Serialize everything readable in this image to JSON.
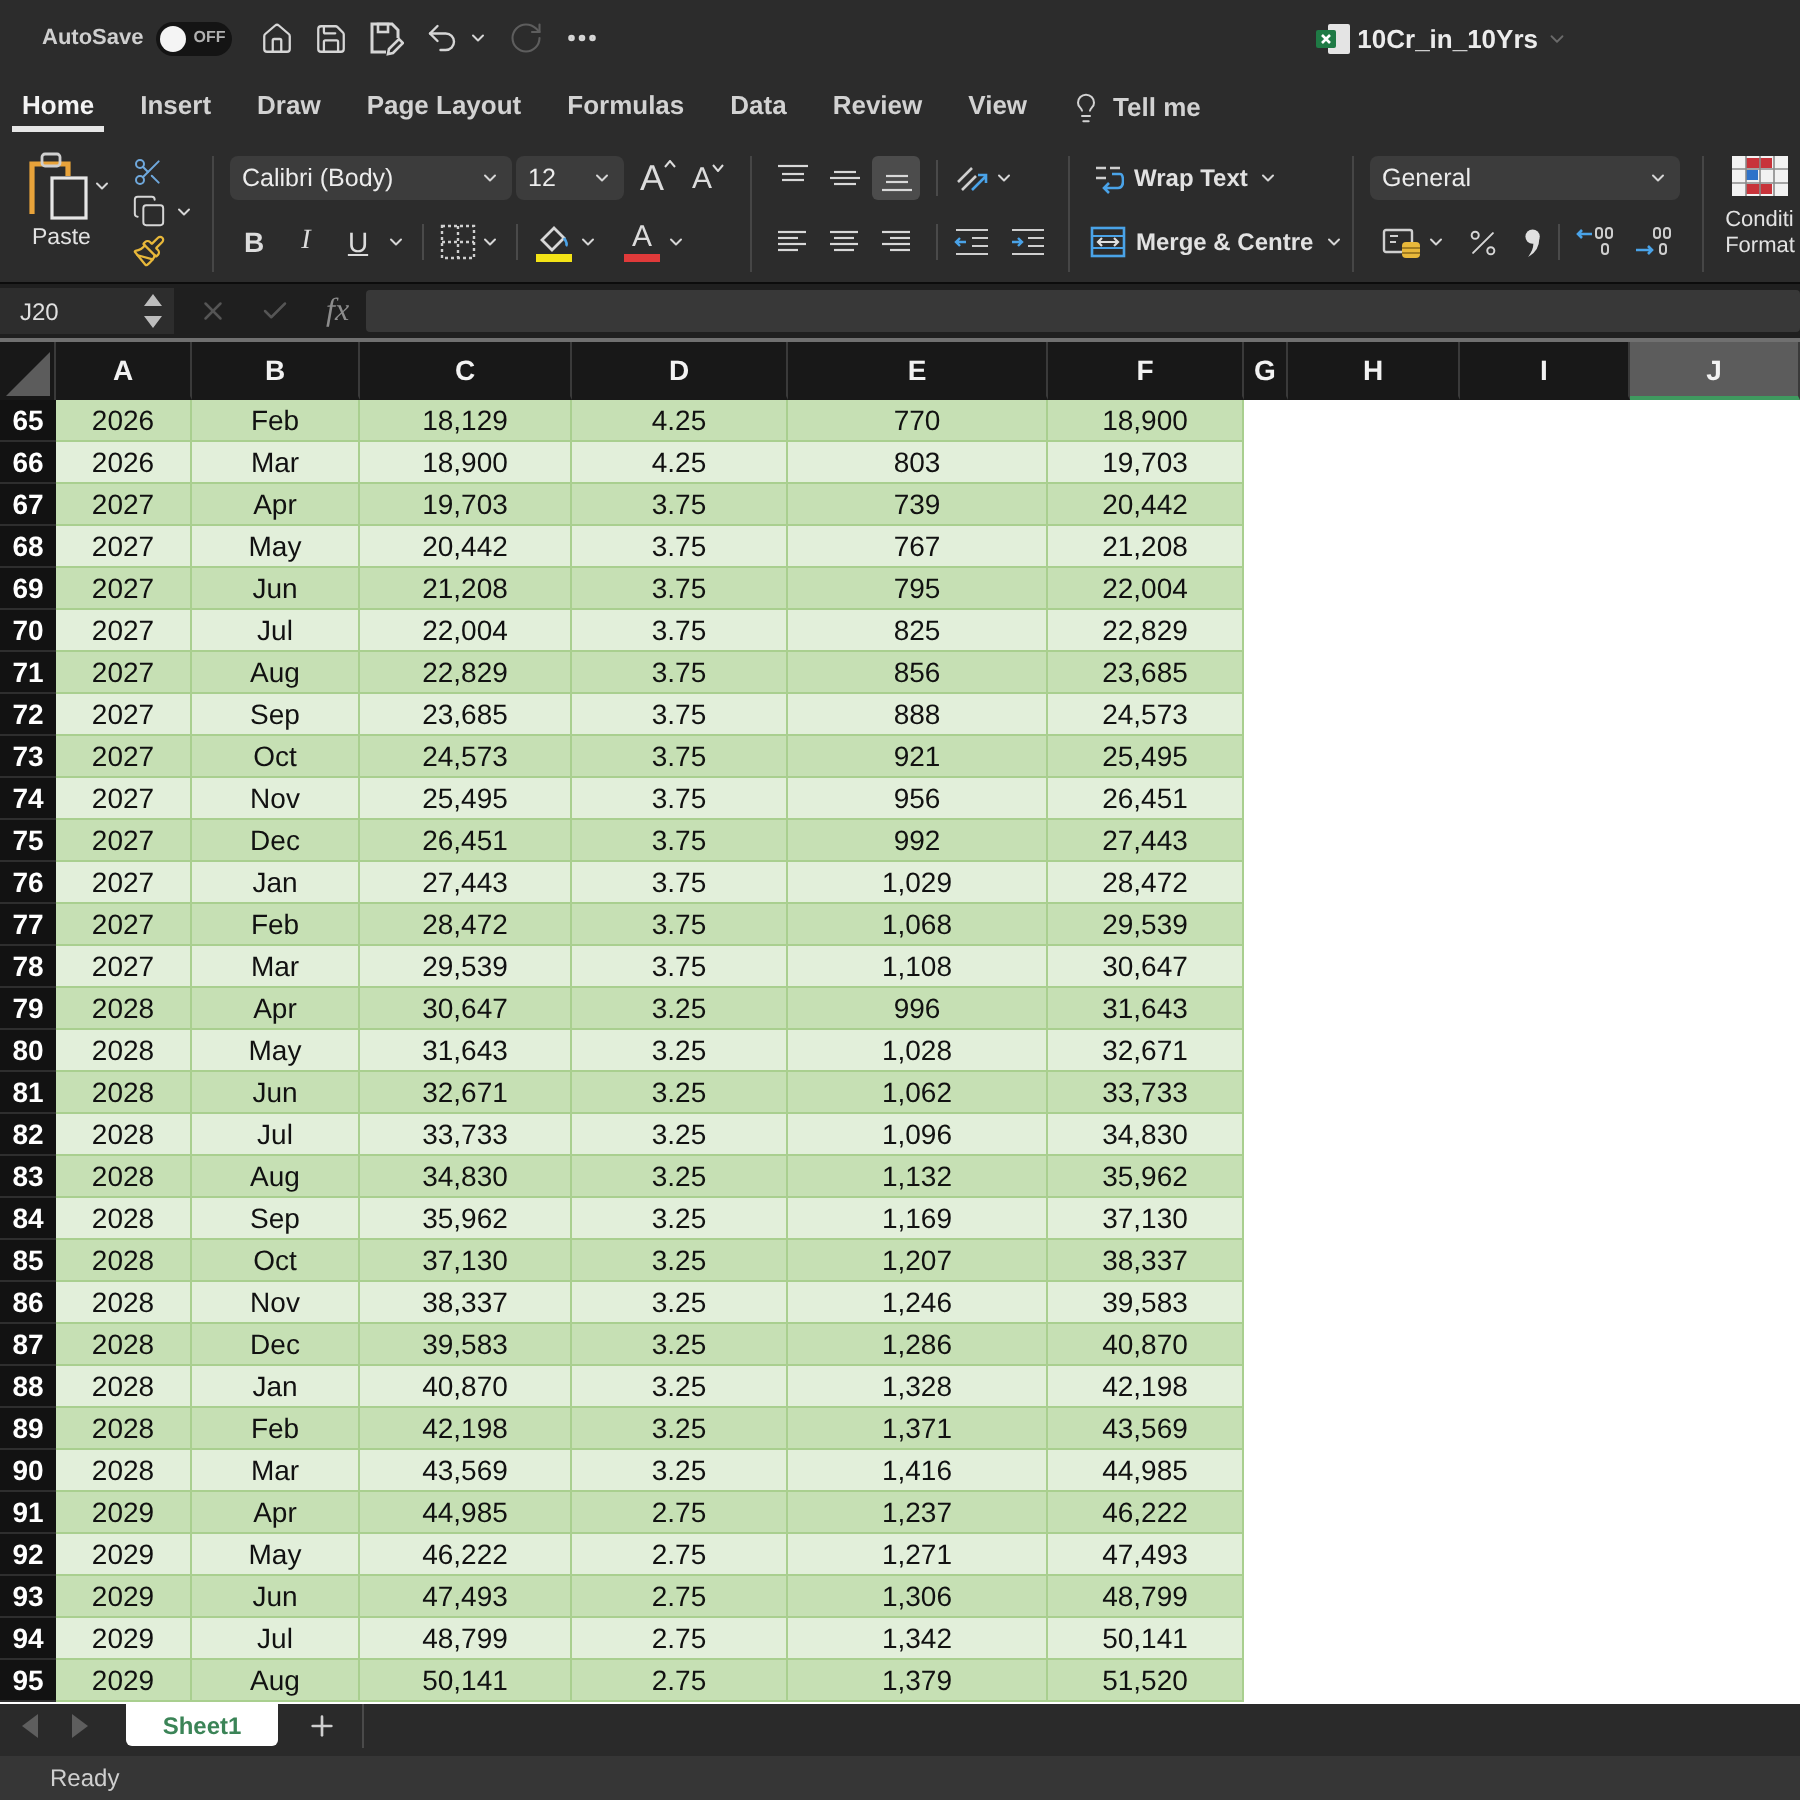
{
  "title_bar": {
    "autosave_label": "AutoSave",
    "autosave_on": false,
    "autosave_state": "OFF",
    "redo_enabled": false,
    "document_title": "10Cr_in_10Yrs"
  },
  "ribbon_tabs": [
    {
      "label": "Home",
      "selected": true
    },
    {
      "label": "Insert",
      "selected": false
    },
    {
      "label": "Draw",
      "selected": false
    },
    {
      "label": "Page Layout",
      "selected": false
    },
    {
      "label": "Formulas",
      "selected": false
    },
    {
      "label": "Data",
      "selected": false
    },
    {
      "label": "Review",
      "selected": false
    },
    {
      "label": "View",
      "selected": false
    }
  ],
  "tell_me": {
    "label": "Tell me"
  },
  "ribbon": {
    "paste": {
      "label": "Paste"
    },
    "font": {
      "name": "Calibri (Body)",
      "size": "12",
      "size_buttons": [
        {
          "kind": "grow",
          "glyph": "A"
        },
        {
          "kind": "shrink",
          "glyph": "A"
        }
      ],
      "style_buttons": [
        {
          "kind": "bold",
          "glyph": "B",
          "selected": false
        },
        {
          "kind": "italic",
          "glyph": "I",
          "selected": false
        },
        {
          "kind": "underline",
          "glyph": "U",
          "selected": false
        }
      ],
      "font_color_glyph": "A"
    },
    "alignment": {
      "vertical": [
        {
          "kind": "top",
          "selected": false
        },
        {
          "kind": "middle",
          "selected": false
        },
        {
          "kind": "bottom",
          "selected": true
        }
      ],
      "horizontal": [
        {
          "kind": "left",
          "selected": false
        },
        {
          "kind": "center",
          "selected": false
        },
        {
          "kind": "right",
          "selected": false
        }
      ]
    },
    "wrap_text": {
      "label": "Wrap Text"
    },
    "merge": {
      "label": "Merge & Centre"
    },
    "number": {
      "format": "General"
    },
    "conditional_formatting": {
      "label_lines": [
        "Conditi",
        "Format"
      ]
    }
  },
  "formula_bar": {
    "name_box": "J20",
    "edit_buttons_enabled": false,
    "function_label": "fx"
  },
  "sheet": {
    "columns": [
      {
        "label": "A",
        "selected": false
      },
      {
        "label": "B",
        "selected": false
      },
      {
        "label": "C",
        "selected": false
      },
      {
        "label": "D",
        "selected": false
      },
      {
        "label": "E",
        "selected": false
      },
      {
        "label": "F",
        "selected": false
      },
      {
        "label": "G",
        "selected": false
      },
      {
        "label": "H",
        "selected": false
      },
      {
        "label": "I",
        "selected": false
      },
      {
        "label": "J",
        "selected": true
      }
    ],
    "rows": [
      {
        "number": "65",
        "cells": [
          "2026",
          "Feb",
          "18,129",
          "4.25",
          "770",
          "18,900"
        ]
      },
      {
        "number": "66",
        "cells": [
          "2026",
          "Mar",
          "18,900",
          "4.25",
          "803",
          "19,703"
        ]
      },
      {
        "number": "67",
        "cells": [
          "2027",
          "Apr",
          "19,703",
          "3.75",
          "739",
          "20,442"
        ]
      },
      {
        "number": "68",
        "cells": [
          "2027",
          "May",
          "20,442",
          "3.75",
          "767",
          "21,208"
        ]
      },
      {
        "number": "69",
        "cells": [
          "2027",
          "Jun",
          "21,208",
          "3.75",
          "795",
          "22,004"
        ]
      },
      {
        "number": "70",
        "cells": [
          "2027",
          "Jul",
          "22,004",
          "3.75",
          "825",
          "22,829"
        ]
      },
      {
        "number": "71",
        "cells": [
          "2027",
          "Aug",
          "22,829",
          "3.75",
          "856",
          "23,685"
        ]
      },
      {
        "number": "72",
        "cells": [
          "2027",
          "Sep",
          "23,685",
          "3.75",
          "888",
          "24,573"
        ]
      },
      {
        "number": "73",
        "cells": [
          "2027",
          "Oct",
          "24,573",
          "3.75",
          "921",
          "25,495"
        ]
      },
      {
        "number": "74",
        "cells": [
          "2027",
          "Nov",
          "25,495",
          "3.75",
          "956",
          "26,451"
        ]
      },
      {
        "number": "75",
        "cells": [
          "2027",
          "Dec",
          "26,451",
          "3.75",
          "992",
          "27,443"
        ]
      },
      {
        "number": "76",
        "cells": [
          "2027",
          "Jan",
          "27,443",
          "3.75",
          "1,029",
          "28,472"
        ]
      },
      {
        "number": "77",
        "cells": [
          "2027",
          "Feb",
          "28,472",
          "3.75",
          "1,068",
          "29,539"
        ]
      },
      {
        "number": "78",
        "cells": [
          "2027",
          "Mar",
          "29,539",
          "3.75",
          "1,108",
          "30,647"
        ]
      },
      {
        "number": "79",
        "cells": [
          "2028",
          "Apr",
          "30,647",
          "3.25",
          "996",
          "31,643"
        ]
      },
      {
        "number": "80",
        "cells": [
          "2028",
          "May",
          "31,643",
          "3.25",
          "1,028",
          "32,671"
        ]
      },
      {
        "number": "81",
        "cells": [
          "2028",
          "Jun",
          "32,671",
          "3.25",
          "1,062",
          "33,733"
        ]
      },
      {
        "number": "82",
        "cells": [
          "2028",
          "Jul",
          "33,733",
          "3.25",
          "1,096",
          "34,830"
        ]
      },
      {
        "number": "83",
        "cells": [
          "2028",
          "Aug",
          "34,830",
          "3.25",
          "1,132",
          "35,962"
        ]
      },
      {
        "number": "84",
        "cells": [
          "2028",
          "Sep",
          "35,962",
          "3.25",
          "1,169",
          "37,130"
        ]
      },
      {
        "number": "85",
        "cells": [
          "2028",
          "Oct",
          "37,130",
          "3.25",
          "1,207",
          "38,337"
        ]
      },
      {
        "number": "86",
        "cells": [
          "2028",
          "Nov",
          "38,337",
          "3.25",
          "1,246",
          "39,583"
        ]
      },
      {
        "number": "87",
        "cells": [
          "2028",
          "Dec",
          "39,583",
          "3.25",
          "1,286",
          "40,870"
        ]
      },
      {
        "number": "88",
        "cells": [
          "2028",
          "Jan",
          "40,870",
          "3.25",
          "1,328",
          "42,198"
        ]
      },
      {
        "number": "89",
        "cells": [
          "2028",
          "Feb",
          "42,198",
          "3.25",
          "1,371",
          "43,569"
        ]
      },
      {
        "number": "90",
        "cells": [
          "2028",
          "Mar",
          "43,569",
          "3.25",
          "1,416",
          "44,985"
        ]
      },
      {
        "number": "91",
        "cells": [
          "2029",
          "Apr",
          "44,985",
          "2.75",
          "1,237",
          "46,222"
        ]
      },
      {
        "number": "92",
        "cells": [
          "2029",
          "May",
          "46,222",
          "2.75",
          "1,271",
          "47,493"
        ]
      },
      {
        "number": "93",
        "cells": [
          "2029",
          "Jun",
          "47,493",
          "2.75",
          "1,306",
          "48,799"
        ]
      },
      {
        "number": "94",
        "cells": [
          "2029",
          "Jul",
          "48,799",
          "2.75",
          "1,342",
          "50,141"
        ]
      },
      {
        "number": "95",
        "cells": [
          "2029",
          "Aug",
          "50,141",
          "2.75",
          "1,379",
          "51,520"
        ]
      }
    ]
  },
  "sheet_tabs": [
    {
      "label": "Sheet1",
      "selected": true
    }
  ],
  "status_bar": {
    "text": "Ready"
  }
}
